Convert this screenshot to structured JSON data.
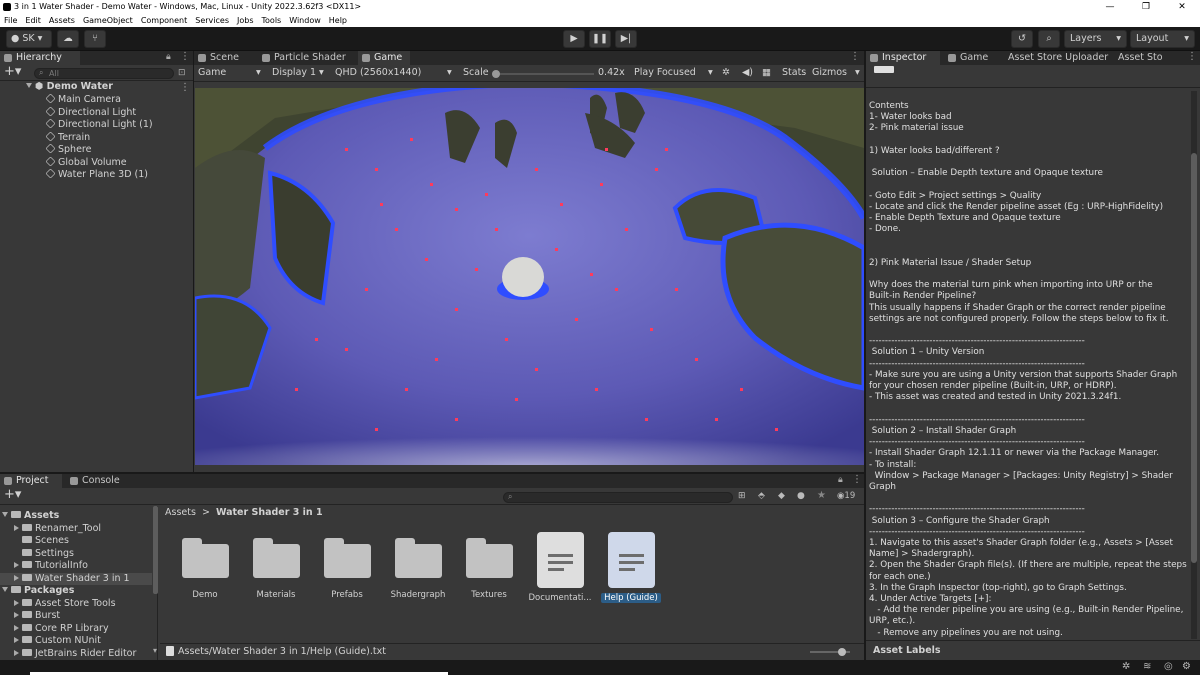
{
  "window": {
    "title": "3 in 1 Water Shader - Demo Water - Windows, Mac, Linux - Unity 2022.3.62f3 <DX11>",
    "controls": [
      "—",
      "❐",
      "✕"
    ]
  },
  "menu": [
    "File",
    "Edit",
    "Assets",
    "GameObject",
    "Component",
    "Services",
    "Jobs",
    "Tools",
    "Window",
    "Help"
  ],
  "toolbar": {
    "account": "SK",
    "layers": "Layers",
    "layout": "Layout"
  },
  "hierarchy": {
    "tab": "Hierarchy",
    "search_placeholder": "All",
    "scene": "Demo Water",
    "items": [
      "Main Camera",
      "Directional Light",
      "Directional Light (1)",
      "Terrain",
      "Sphere",
      "Global Volume",
      "Water Plane 3D (1)"
    ]
  },
  "center_tabs": [
    "Scene",
    "Particle Shader",
    "Game"
  ],
  "game_bar": {
    "view": "Game",
    "display": "Display 1",
    "resolution": "QHD (2560x1440)",
    "scale_label": "Scale",
    "scale_value": "0.42x",
    "play_mode": "Play Focused",
    "stats": "Stats",
    "gizmos": "Gizmos"
  },
  "right_tabs": [
    "Inspector",
    "Game",
    "Asset Store Uploader",
    "Asset Sto"
  ],
  "inspector_lines": [
    "Contents",
    "1- Water looks bad",
    "2- Pink material issue",
    "",
    "1) Water looks bad/different ?",
    "",
    " Solution – Enable Depth texture and Opaque texture",
    "",
    "- Goto Edit > Project settings > Quality",
    "- Locate and click the Render pipeline asset (Eg : URP-HighFidelity)",
    "- Enable Depth Texture and Opaque texture",
    "- Done.",
    "",
    "",
    "2) Pink Material Issue / Shader Setup",
    "",
    "Why does the material turn pink when importing into URP or the",
    "Built-in Render Pipeline?",
    "This usually happens if Shader Graph or the correct render pipeline",
    "settings are not configured properly. Follow the steps below to fix it.",
    "",
    "--------------------------------------------------------------------",
    " Solution 1 – Unity Version",
    "--------------------------------------------------------------------",
    "- Make sure you are using a Unity version that supports Shader Graph",
    "for your chosen render pipeline (Built-in, URP, or HDRP).",
    "- This asset was created and tested in Unity 2021.3.24f1.",
    "",
    "--------------------------------------------------------------------",
    " Solution 2 – Install Shader Graph",
    "--------------------------------------------------------------------",
    "- Install Shader Graph 12.1.11 or newer via the Package Manager.",
    "- To install:",
    "  Window > Package Manager > [Packages: Unity Registry] > Shader",
    "Graph",
    "",
    "--------------------------------------------------------------------",
    " Solution 3 – Configure the Shader Graph",
    "--------------------------------------------------------------------",
    "1. Navigate to this asset's Shader Graph folder (e.g., Assets > [Asset",
    "Name] > Shadergraph).",
    "2. Open the Shader Graph file(s). (If there are multiple, repeat the steps",
    "for each one.)",
    "3. In the Graph Inspector (top-right), go to Graph Settings.",
    "4. Under Active Targets [+]:",
    "   - Add the render pipeline you are using (e.g., Built-in Render Pipeline,",
    "URP, etc.).",
    "   - Remove any pipelines you are not using."
  ],
  "asset_labels": "Asset Labels",
  "bottom_tabs": [
    "Project",
    "Console"
  ],
  "project": {
    "assets_root": "Assets",
    "assets_children": [
      "Renamer_Tool",
      "Scenes",
      "Settings",
      "TutorialInfo",
      "Water Shader 3 in 1"
    ],
    "packages_root": "Packages",
    "packages_children": [
      "Asset Store Tools",
      "Burst",
      "Core RP Library",
      "Custom NUnit",
      "JetBrains Rider Editor"
    ],
    "breadcrumb_root": "Assets",
    "breadcrumb_sep": ">",
    "breadcrumb_current": "Water Shader 3 in 1",
    "hidden_count": "19",
    "folders": [
      "Demo",
      "Materials",
      "Prefabs",
      "Shadergraph",
      "Textures"
    ],
    "files": [
      "Documentati...",
      "Help (Guide)"
    ],
    "selected_path": "Assets/Water Shader 3 in 1/Help (Guide).txt"
  },
  "colors": {
    "accent": "#2c5d87",
    "selection": "#4d7fb8",
    "panel": "#383838",
    "water_glow": "#2f4dff",
    "particle": "#ff3a5c"
  }
}
